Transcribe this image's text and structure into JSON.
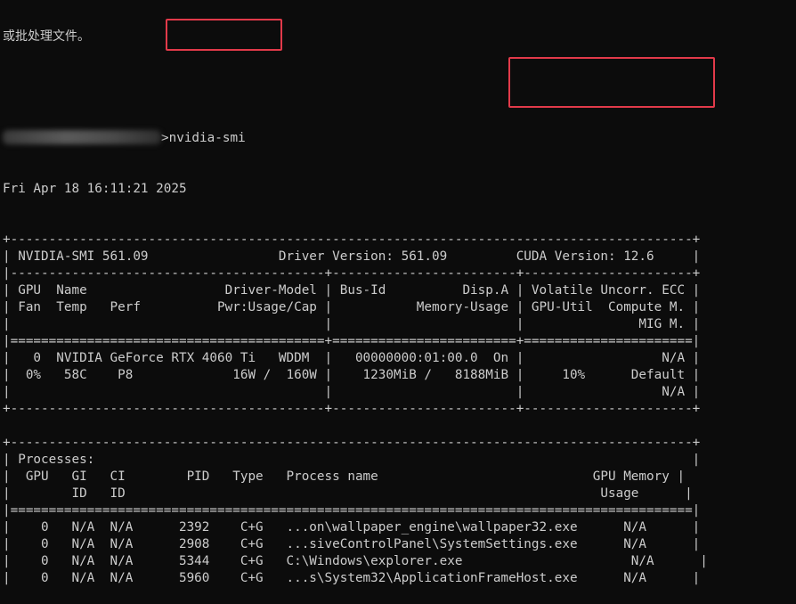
{
  "terminal": {
    "top_text": "或批处理文件。",
    "prompt_suffix": ">",
    "command": "nvidia-smi",
    "timestamp": "Fri Apr 18 16:11:21 2025",
    "lines": [
      "+-----------------------------------------------------------------------------------------+",
      "| NVIDIA-SMI 561.09                 Driver Version: 561.09         CUDA Version: 12.6     |",
      "|-----------------------------------------+------------------------+----------------------+",
      "| GPU  Name                  Driver-Model | Bus-Id          Disp.A | Volatile Uncorr. ECC |",
      "| Fan  Temp   Perf          Pwr:Usage/Cap |           Memory-Usage | GPU-Util  Compute M. |",
      "|                                         |                        |               MIG M. |",
      "|=========================================+========================+======================|",
      "|   0  NVIDIA GeForce RTX 4060 Ti   WDDM  |   00000000:01:00.0  On |                  N/A |",
      "|  0%   58C    P8             16W /  160W |    1230MiB /   8188MiB |     10%      Default |",
      "|                                         |                        |                  N/A |",
      "+-----------------------------------------+------------------------+----------------------+",
      "",
      "+-----------------------------------------------------------------------------------------+",
      "| Processes:                                                                              |",
      "|  GPU   GI   CI        PID   Type   Process name                            GPU Memory |",
      "|        ID   ID                                                              Usage      |",
      "|=========================================================================================|",
      "|    0   N/A  N/A      2392    C+G   ...on\\wallpaper_engine\\wallpaper32.exe      N/A      |",
      "|    0   N/A  N/A      2908    C+G   ...siveControlPanel\\SystemSettings.exe      N/A      |",
      "|    0   N/A  N/A      5344    C+G   C:\\Windows\\explorer.exe                      N/A      |",
      "|    0   N/A  N/A      5960    C+G   ...s\\System32\\ApplicationFrameHost.exe      N/A      |"
    ]
  },
  "colors": {
    "background": "#0c0c0c",
    "text": "#cccccc",
    "annotation": "#e23a4a"
  }
}
